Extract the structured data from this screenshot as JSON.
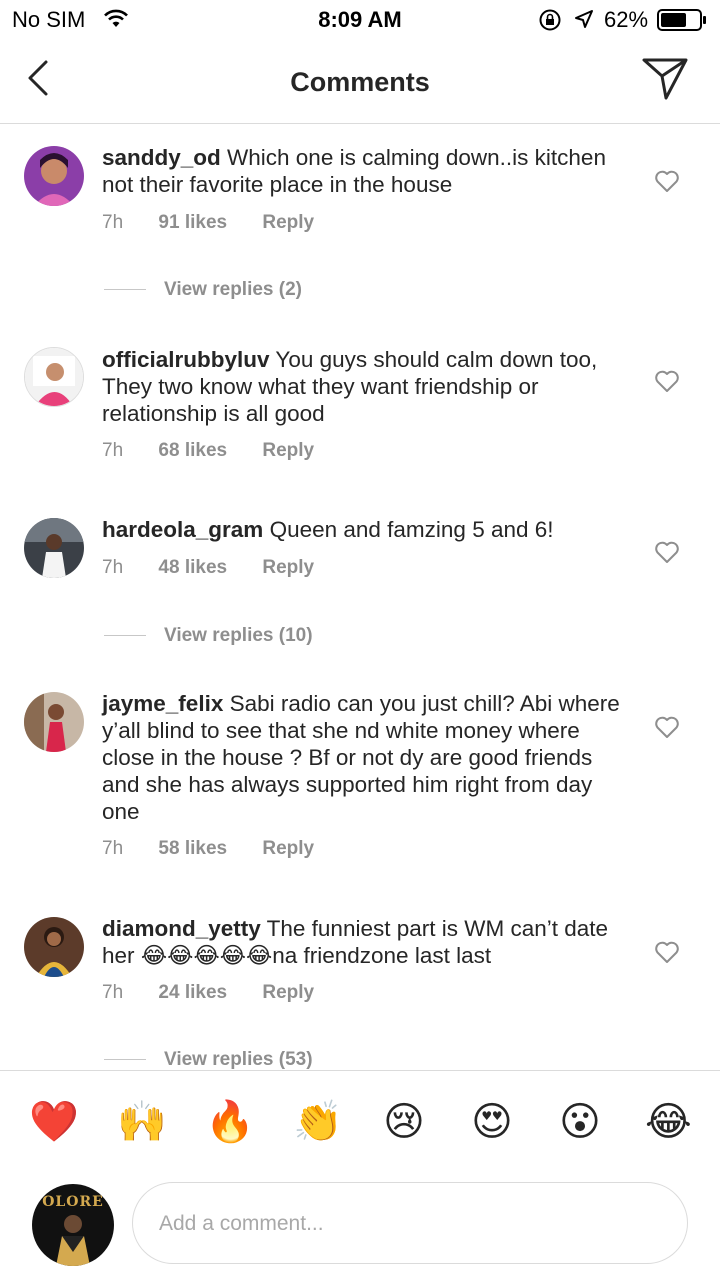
{
  "status_bar": {
    "carrier": "No SIM",
    "time": "8:09 AM",
    "battery": "62%"
  },
  "header": {
    "title": "Comments"
  },
  "comments": [
    {
      "username": "sanddy_od",
      "text": " Which one is calming down..is kitchen not their favorite place in the house",
      "time": "7h",
      "likes": "91 likes",
      "reply": "Reply",
      "view_replies": "View replies (2)"
    },
    {
      "username": "officialrubbyluv",
      "text": " You guys should calm down too, They two know what they want friendship or relationship is all good",
      "time": "7h",
      "likes": "68 likes",
      "reply": "Reply"
    },
    {
      "username": "hardeola_gram",
      "text": " Queen and famzing 5 and 6!",
      "time": "7h",
      "likes": "48 likes",
      "reply": "Reply",
      "view_replies": "View replies (10)"
    },
    {
      "username": "jayme_felix",
      "text": " Sabi radio can you just chill? Abi where y’all blind to see that she nd white money where close in the house ? Bf or not dy are good friends and she has always supported him right from day one",
      "time": "7h",
      "likes": "58 likes",
      "reply": "Reply"
    },
    {
      "username": "diamond_yetty",
      "text": " The funniest part is WM can’t date her 😂😂😂😂😂na friendzone last last",
      "time": "7h",
      "likes": "24 likes",
      "reply": "Reply",
      "view_replies": "View replies (53)"
    }
  ],
  "emoji_bar": [
    "❤️",
    "🙌",
    "🔥",
    "👏",
    "😢",
    "😍",
    "😮",
    "😂"
  ],
  "composer": {
    "placeholder": "Add a comment...",
    "avatar_text": "OLORE"
  }
}
